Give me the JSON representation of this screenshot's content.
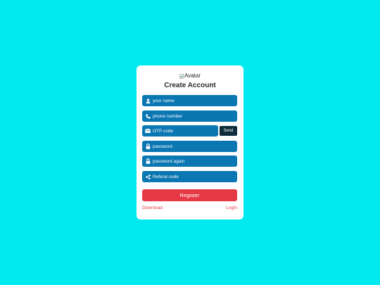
{
  "page": {
    "background_color": "#00eaf0"
  },
  "card": {
    "avatar_alt": "Avatar",
    "title": "Create Account"
  },
  "form": {
    "fields": [
      {
        "name": "name",
        "icon": "user-icon",
        "placeholder": "your name",
        "value": ""
      },
      {
        "name": "phone",
        "icon": "phone-icon",
        "placeholder": "phone number",
        "value": ""
      },
      {
        "name": "otp",
        "icon": "envelope-icon",
        "placeholder": "OTP code",
        "value": ""
      },
      {
        "name": "password",
        "icon": "lock-icon",
        "placeholder": "password",
        "value": ""
      },
      {
        "name": "password_again",
        "icon": "lock-icon",
        "placeholder": "password again",
        "value": ""
      },
      {
        "name": "referral",
        "icon": "share-icon",
        "placeholder": "Referal code",
        "value": ""
      }
    ],
    "send_label": "Send",
    "register_label": "Register"
  },
  "links": {
    "download": "Download",
    "login": "Login"
  },
  "colors": {
    "field_bg": "#0a76b2",
    "send_bg": "#0d2c3c",
    "accent": "#e53946",
    "card_bg": "#ffffff"
  }
}
